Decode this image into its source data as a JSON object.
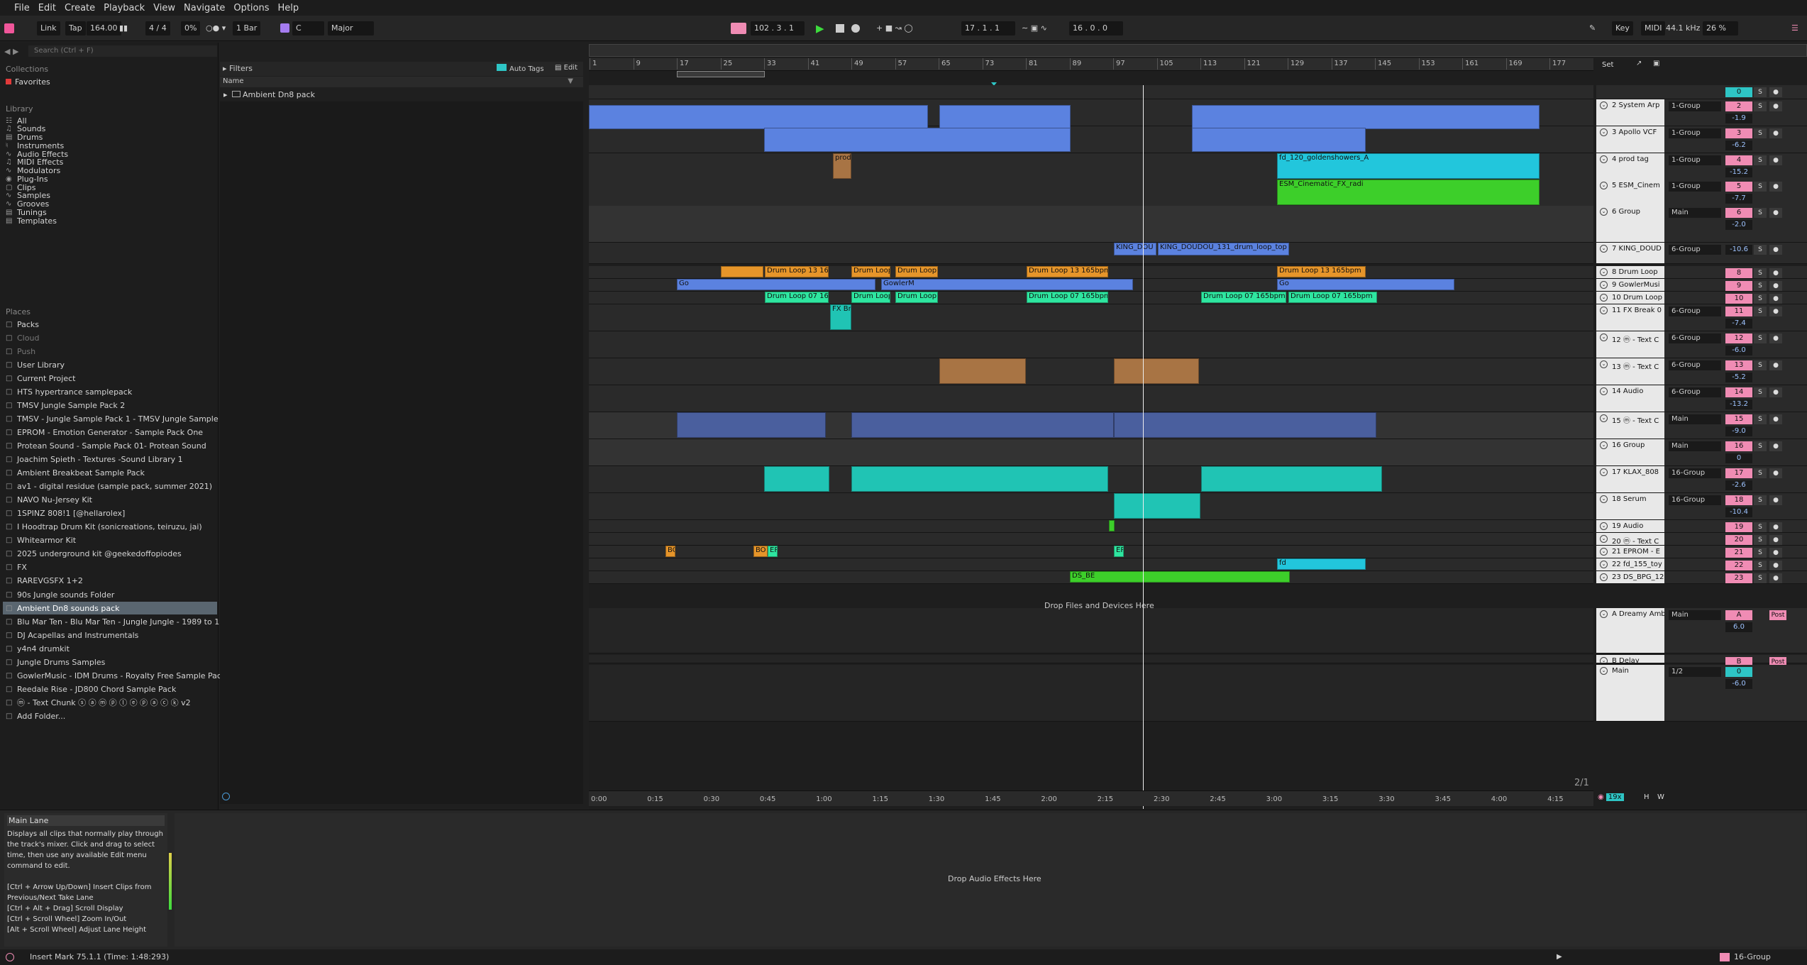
{
  "menu": [
    "File",
    "Edit",
    "Create",
    "Playback",
    "View",
    "Navigate",
    "Options",
    "Help"
  ],
  "transport": {
    "link": "Link",
    "tap": "Tap",
    "tempo": "164.00",
    "meter": "4 / 4",
    "cpu": "0%",
    "quant": "1 Bar",
    "key": "C",
    "scale": "Major",
    "position": "102 .  3 .  1",
    "loop_start": "17 .  1 .  1",
    "loop_len": "16 .  0 .  0",
    "key_btn": "Key",
    "midi_btn": "MIDI",
    "sample_rate": "44.1 kHz",
    "cpu_load": "26 %"
  },
  "browser": {
    "search_placeholder": "Search (Ctrl + F)",
    "collections_title": "Collections",
    "favorites": "Favorites",
    "library_title": "Library",
    "library": [
      "All",
      "Sounds",
      "Drums",
      "Instruments",
      "Audio Effects",
      "MIDI Effects",
      "Modulators",
      "Plug-Ins",
      "Clips",
      "Samples",
      "Grooves",
      "Tunings",
      "Templates"
    ],
    "places_title": "Places",
    "places": [
      "Packs",
      "Cloud",
      "Push",
      "User Library",
      "Current Project",
      "HTS hypertrance samplepack",
      "TMSV Jungle Sample Pack 2",
      "TMSV - Jungle Sample Pack 1 - TMSV Jungle Sample Pac",
      "EPROM - Emotion Generator - Sample Pack One",
      "Protean Sound - Sample Pack 01- Protean Sound",
      "Joachim Spieth - Textures -Sound Library 1",
      "Ambient Breakbeat Sample Pack",
      "av1 - digital residue (sample pack, summer 2021)",
      "NAVO Nu-Jersey Kit",
      "1SPINZ 808!1 [@hellarolex]",
      "I Hoodtrap Drum Kit (sonicreations, teiruzu, jai)",
      "Whitearmor Kit",
      "2025 underground kit @geekedoffopiodes",
      "FX",
      "RAREVGSFX 1+2",
      "90s Jungle sounds Folder",
      "Ambient Dn8 sounds pack",
      "Blu Mar Ten - Blu Mar Ten - Jungle Jungle - 1989 to 1999",
      "DJ Acapellas and Instrumentals",
      "y4n4 drumkit",
      "Jungle Drums Samples",
      "GowlerMusic - IDM Drums - Royalty Free Sample Pack #",
      "Reedale Rise - JD800 Chord Sample Pack",
      "ⓜ - Text Chunk ⓢ ⓐ ⓜ ⓟ ⓛ ⓔ ⓟ ⓐ ⓒ ⓚ v2",
      "Add Folder..."
    ],
    "filters": "Filters",
    "auto_tags": "Auto Tags",
    "edit": "Edit",
    "name_col": "Name",
    "folder": "Ambient Dn8 pack"
  },
  "arrangement": {
    "bars": [
      "1",
      "9",
      "17",
      "25",
      "33",
      "41",
      "49",
      "57",
      "65",
      "73",
      "81",
      "89",
      "97",
      "105",
      "113",
      "121",
      "129",
      "137",
      "145",
      "153",
      "161",
      "169",
      "177"
    ],
    "times": [
      "0:00",
      "0:15",
      "0:30",
      "0:45",
      "1:00",
      "1:15",
      "1:30",
      "1:45",
      "2:00",
      "2:15",
      "2:30",
      "2:45",
      "3:00",
      "3:15",
      "3:30",
      "3:45",
      "4:00",
      "4:15"
    ],
    "drop_files": "Drop Files and Devices Here",
    "page": "2/1",
    "set_btn": "Set",
    "zoom": "19x",
    "h_btn": "H",
    "w_btn": "W",
    "clip_labels": {
      "prod": "prod",
      "fd": "fd",
      "fd_long": "fd_120_goldenshowers_A",
      "esm": "ESM_Cinematic_FX_radi",
      "king_short": "KING_DOU",
      "king": "KING_DOUDOU_131_drum_loop_top",
      "drum13": "Drum Loop 13 165bpm",
      "drum13s": "Drum Loop 13 165",
      "drum13t": "Drum Loop",
      "drum07": "Drum Loop 07 165bpm",
      "drum07s": "Drum Loop 07 165",
      "go": "Go",
      "gowler": "GowlerM",
      "fxbr": "FX Br",
      "bo": "BO",
      "ep": "EP",
      "ds": "DS_BE"
    }
  },
  "tracks": [
    {
      "name": "",
      "route": "",
      "num": "0",
      "vol": "",
      "color": "#2ec5c5"
    },
    {
      "name": "2 System Arp",
      "route": "1-Group",
      "num": "2",
      "vol": "-1.9"
    },
    {
      "name": "3 Apollo VCF",
      "route": "1-Group",
      "num": "3",
      "vol": "-6.2"
    },
    {
      "name": "4 prod tag",
      "route": "1-Group",
      "num": "4",
      "vol": "-15.2"
    },
    {
      "name": "5 ESM_Cinem",
      "route": "1-Group",
      "num": "5",
      "vol": "-7.7"
    },
    {
      "name": "6 Group",
      "route": "Main",
      "num": "6",
      "vol": "-2.0"
    },
    {
      "name": "7 KING_DOUD",
      "route": "6-Group",
      "num": "7",
      "vol": "-10.6"
    },
    {
      "name": "8 Drum Loop",
      "route": "",
      "num": "8",
      "vol": ""
    },
    {
      "name": "9 GowlerMusi",
      "route": "",
      "num": "9",
      "vol": ""
    },
    {
      "name": "10 Drum Loop",
      "route": "",
      "num": "10",
      "vol": ""
    },
    {
      "name": "11 FX Break 0",
      "route": "6-Group",
      "num": "11",
      "vol": "-7.4"
    },
    {
      "name": "12 ⓜ - Text C",
      "route": "6-Group",
      "num": "12",
      "vol": "-6.0"
    },
    {
      "name": "13 ⓜ - Text C",
      "route": "6-Group",
      "num": "13",
      "vol": "-5.2"
    },
    {
      "name": "14 Audio",
      "route": "6-Group",
      "num": "14",
      "vol": "-13.2"
    },
    {
      "name": "15 ⓜ - Text C",
      "route": "Main",
      "num": "15",
      "vol": "-9.0"
    },
    {
      "name": "16 Group",
      "route": "Main",
      "num": "16",
      "vol": "0"
    },
    {
      "name": "17 KLAX_808",
      "route": "16-Group",
      "num": "17",
      "vol": "-2.6"
    },
    {
      "name": "18 Serum",
      "route": "16-Group",
      "num": "18",
      "vol": "-10.4"
    },
    {
      "name": "19 Audio",
      "route": "",
      "num": "19",
      "vol": ""
    },
    {
      "name": "20 ⓜ - Text C",
      "route": "",
      "num": "20",
      "vol": ""
    },
    {
      "name": "21 EPROM - E",
      "route": "",
      "num": "21",
      "vol": ""
    },
    {
      "name": "22 fd_155_toy",
      "route": "",
      "num": "22",
      "vol": ""
    },
    {
      "name": "23 DS_BPG_12",
      "route": "",
      "num": "23",
      "vol": ""
    }
  ],
  "returns": [
    {
      "name": "A Dreamy Amb",
      "route": "Main",
      "num": "A",
      "vol": "6.0",
      "post": "Post"
    },
    {
      "name": "B Delay",
      "route": "",
      "num": "B",
      "vol": "",
      "post": "Post"
    },
    {
      "name": "Main",
      "route": "1/2",
      "num": "0",
      "vol": "-6.0",
      "post": ""
    }
  ],
  "info": {
    "title": "Main Lane",
    "lines": [
      "Displays all clips that normally play through",
      "the track's mixer. Click and drag to select",
      "time, then use any available Edit menu",
      "command to edit.",
      "",
      "[Ctrl + Arrow Up/Down] Insert Clips from",
      "Previous/Next Take Lane",
      "[Ctrl + Alt + Drag] Scroll Display",
      "[Ctrl + Scroll Wheel] Zoom In/Out",
      "[Alt + Scroll Wheel] Adjust Lane Height"
    ]
  },
  "device_drop": "Drop Audio Effects Here",
  "status": {
    "text": "Insert Mark 75.1.1 (Time: 1:48:293)",
    "right": "16-Group"
  },
  "colors": {
    "blue": "#5b82e0",
    "cyan": "#22c6dc",
    "green": "#3dcf2a",
    "orange": "#e6952a",
    "teal": "#20c4b4",
    "mint": "#2ee6a0",
    "brown": "#a87444",
    "pink": "#f08cb4"
  }
}
